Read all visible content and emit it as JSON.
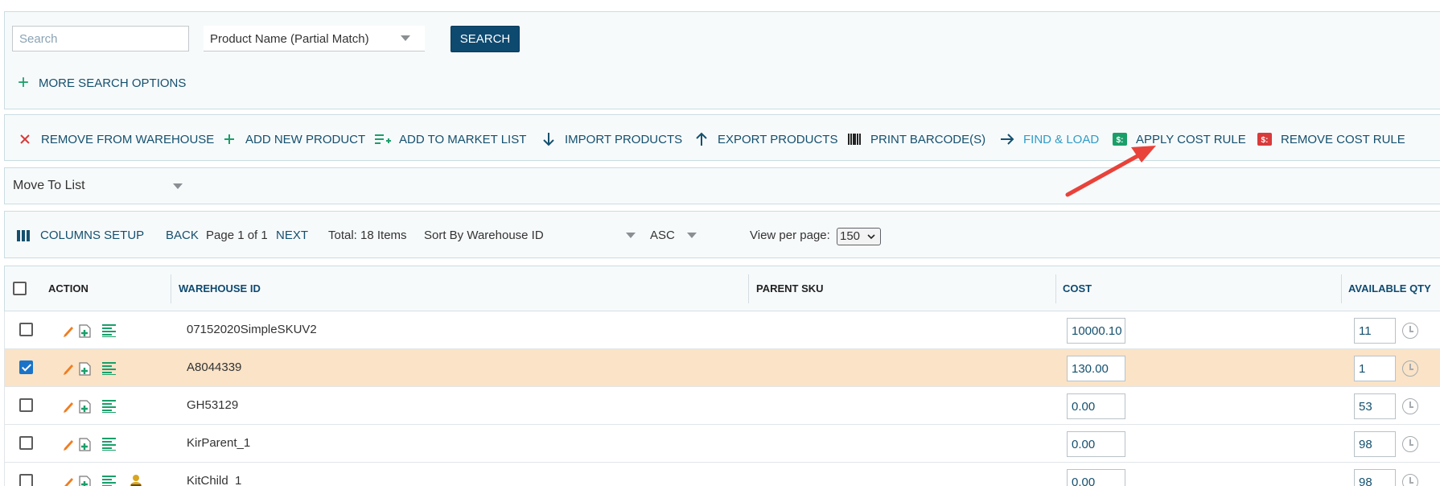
{
  "search": {
    "placeholder": "Search",
    "field_selected": "Product Name (Partial Match)",
    "button_label": "SEARCH",
    "more_options_label": "MORE SEARCH OPTIONS"
  },
  "toolbar": {
    "remove_from_warehouse": "REMOVE FROM WAREHOUSE",
    "add_new_product": "ADD NEW PRODUCT",
    "add_to_market_list": "ADD TO MARKET LIST",
    "import_products": "IMPORT PRODUCTS",
    "export_products": "EXPORT PRODUCTS",
    "print_barcodes": "PRINT BARCODE(S)",
    "find_and_load": "FIND & LOAD",
    "apply_cost_rule": "APPLY COST RULE",
    "remove_cost_rule": "REMOVE COST RULE",
    "cost_icon_glyph": "$:"
  },
  "move_to_list": {
    "label": "Move To List"
  },
  "pagination": {
    "columns_setup": "COLUMNS SETUP",
    "back": "BACK",
    "page_info": "Page 1 of 1",
    "next": "NEXT",
    "total": "Total: 18 Items",
    "sort_by": "Sort By Warehouse ID",
    "sort_order": "ASC",
    "view_per_page_label": "View per page:",
    "view_per_page_value": "150"
  },
  "table": {
    "headers": {
      "action": "ACTION",
      "warehouse_id": "WAREHOUSE ID",
      "parent_sku": "PARENT SKU",
      "cost": "COST",
      "available_qty": "AVAILABLE QTY"
    },
    "rows": [
      {
        "warehouse_id": "07152020SimpleSKUV2",
        "parent_sku": "",
        "cost": "10000.10",
        "available_qty": "11",
        "selected": false
      },
      {
        "warehouse_id": "A8044339",
        "parent_sku": "",
        "cost": "130.00",
        "available_qty": "1",
        "selected": true
      },
      {
        "warehouse_id": "GH53129",
        "parent_sku": "",
        "cost": "0.00",
        "available_qty": "53",
        "selected": false
      },
      {
        "warehouse_id": "KirParent_1",
        "parent_sku": "",
        "cost": "0.00",
        "available_qty": "98",
        "selected": false
      },
      {
        "warehouse_id": "KitChild_1",
        "parent_sku": "",
        "cost": "0.00",
        "available_qty": "98",
        "selected": false
      }
    ]
  },
  "colors": {
    "primary": "#0e4a70",
    "accent_green": "#1a9f6a",
    "remove_red": "#d93a3a",
    "selected_row": "#fae3c7",
    "annotation_arrow": "#e8423a"
  }
}
